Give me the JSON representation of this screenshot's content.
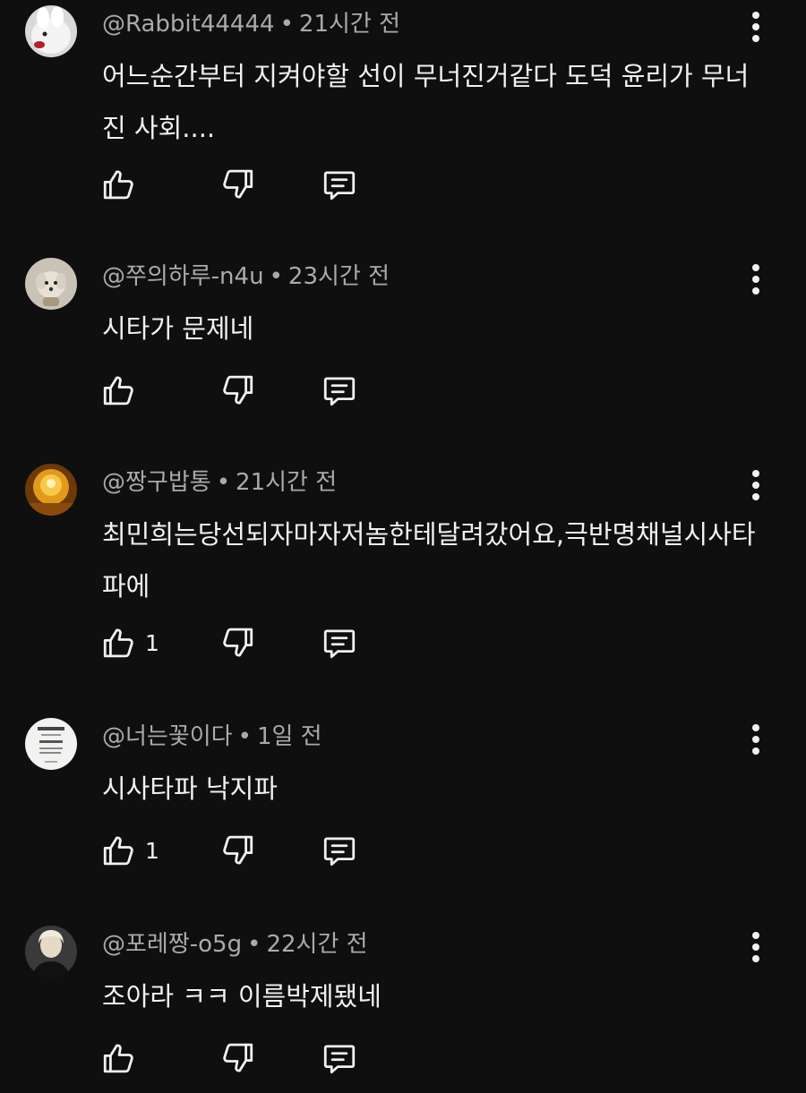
{
  "comments": [
    {
      "author": "@Rabbit44444",
      "time": "21시간 전",
      "text": "어느순간부터 지켜야할 선이 무너진거같다 도덕 윤리가 무너진 사회....",
      "likes": "",
      "avatar": "white-rabbit"
    },
    {
      "author": "@쭈의하루-n4u",
      "time": "23시간 전",
      "text": "시타가 문제네",
      "likes": "",
      "avatar": "puppy"
    },
    {
      "author": "@짱구밥통",
      "time": "21시간 전",
      "text": "최민희는당선되자마자저놈한테달려갔어요,극반명채널시사타파에",
      "likes": "1",
      "avatar": "golden-light"
    },
    {
      "author": "@너는꽃이다",
      "time": "1일 전",
      "text": "시사타파 낙지파",
      "likes": "1",
      "avatar": "text-card"
    },
    {
      "author": "@포레짱-o5g",
      "time": "22시간 전",
      "text": "조아라 ㅋㅋ 이름박제됐네",
      "likes": "",
      "avatar": "person-dark-jacket"
    }
  ],
  "separator": "•",
  "icons": {
    "like": "thumbs-up-icon",
    "dislike": "thumbs-down-icon",
    "reply": "comment-reply-icon",
    "menu": "more-vertical-icon"
  },
  "colors": {
    "background": "#0f0f0f",
    "text": "#f1f1f1",
    "meta": "#aaaaaa"
  }
}
